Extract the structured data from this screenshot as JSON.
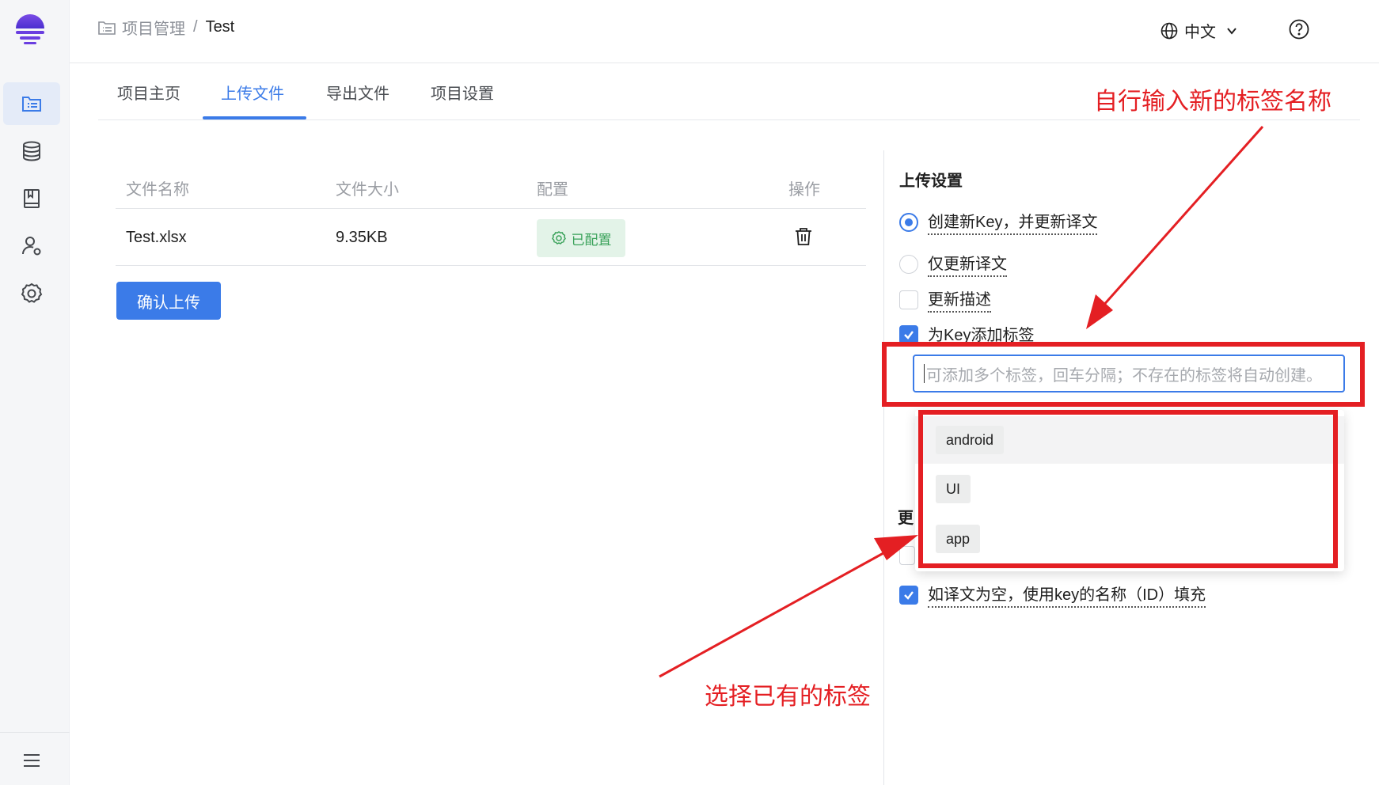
{
  "sidebar": {
    "items": [
      {
        "icon": "project-list-icon",
        "active": true
      },
      {
        "icon": "database-icon",
        "active": false
      },
      {
        "icon": "book-icon",
        "active": false
      },
      {
        "icon": "user-settings-icon",
        "active": false
      },
      {
        "icon": "gear-icon",
        "active": false
      }
    ],
    "menu_icon": "menu-icon"
  },
  "header": {
    "breadcrumb_root": "项目管理",
    "breadcrumb_sep": "/",
    "breadcrumb_current": "Test",
    "language": "中文"
  },
  "tabs": [
    {
      "label": "项目主页",
      "active": false
    },
    {
      "label": "上传文件",
      "active": true
    },
    {
      "label": "导出文件",
      "active": false
    },
    {
      "label": "项目设置",
      "active": false
    }
  ],
  "table": {
    "columns": [
      "文件名称",
      "文件大小",
      "配置",
      "操作"
    ],
    "rows": [
      {
        "name": "Test.xlsx",
        "size": "9.35KB",
        "config": "已配置"
      }
    ]
  },
  "confirm_upload": "确认上传",
  "upload_settings": {
    "title": "上传设置",
    "options": {
      "create_new_key": "创建新Key，并更新译文",
      "update_only": "仅更新译文",
      "update_description": "更新描述",
      "add_tags": "为Key添加标签"
    },
    "tag_placeholder": "可添加多个标签，回车分隔；不存在的标签将自动创建。",
    "tag_suggestions": [
      "android",
      "UI",
      "app"
    ],
    "partially_hidden_title": "更",
    "fill_empty": "如译文为空，使用key的名称（ID）填充"
  },
  "annotations": {
    "top": "自行输入新的标签名称",
    "bottom": "选择已有的标签"
  },
  "colors": {
    "accent": "#3b7be8",
    "success": "#3aa25a",
    "annotation": "#e41f23"
  }
}
